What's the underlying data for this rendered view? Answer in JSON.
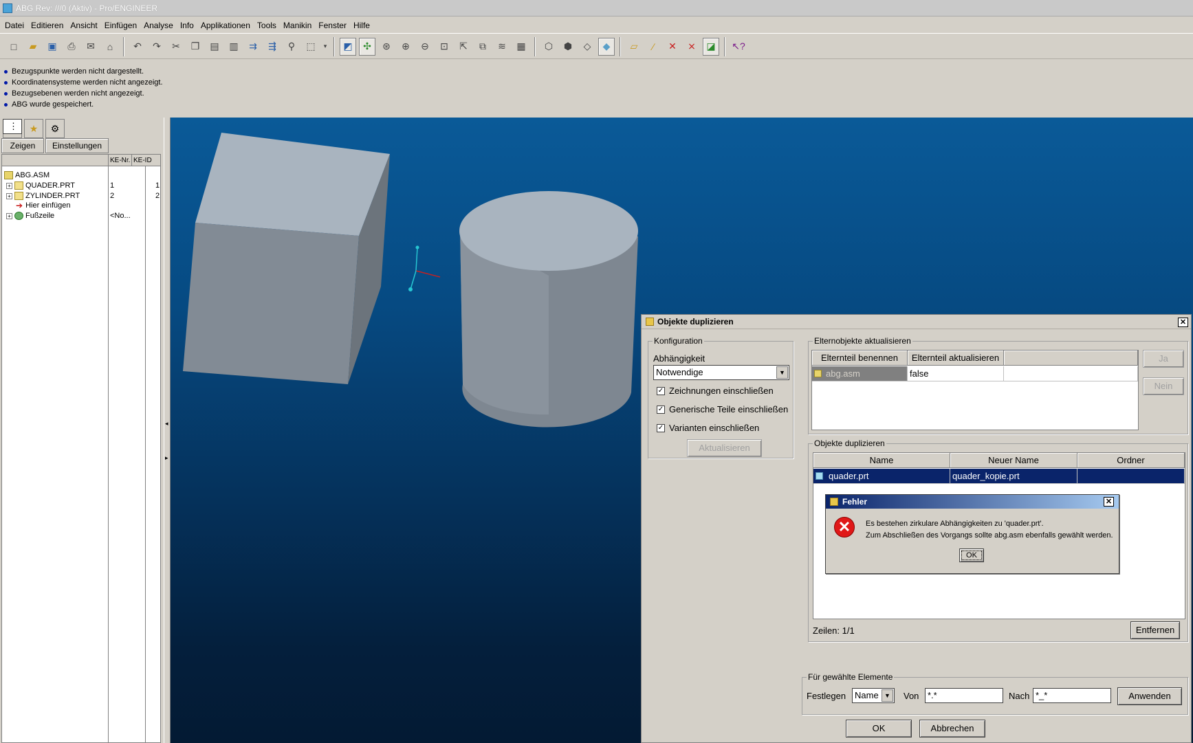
{
  "window": {
    "title": "ABG Rev: ///0 (Aktiv) - Pro/ENGINEER"
  },
  "menu": [
    "Datei",
    "Editieren",
    "Ansicht",
    "Einfügen",
    "Analyse",
    "Info",
    "Applikationen",
    "Tools",
    "Manikin",
    "Fenster",
    "Hilfe"
  ],
  "messages": [
    "Bezugspunkte werden nicht dargestellt.",
    "Koordinatensysteme werden nicht angezeigt.",
    "Bezugsebenen werden nicht angezeigt.",
    "ABG wurde gespeichert."
  ],
  "tree": {
    "show_button": "Zeigen",
    "settings_button": "Einstellungen",
    "col_ke_nr": "KE-Nr.",
    "col_ke_id": "KE-ID",
    "root": "ABG.ASM",
    "items": [
      {
        "label": "QUADER.PRT",
        "ke_nr": "1",
        "ke_id": "1"
      },
      {
        "label": "ZYLINDER.PRT",
        "ke_nr": "2",
        "ke_id": "2"
      },
      {
        "label": "Hier einfügen",
        "ke_nr": "",
        "ke_id": ""
      },
      {
        "label": "Fußzeile",
        "ke_nr": "<No...",
        "ke_id": ""
      }
    ]
  },
  "dialog": {
    "title": "Objekte duplizieren",
    "config": {
      "group_label": "Konfiguration",
      "dependency_label": "Abhängigkeit",
      "dependency_value": "Notwendige",
      "chk_drawings": "Zeichnungen einschließen",
      "chk_generic": "Generische Teile einschließen",
      "chk_variants": "Varianten einschließen",
      "update_button": "Aktualisieren"
    },
    "parents": {
      "group_label": "Elternobjekte aktualisieren",
      "col_name": "Elternteil benennen",
      "col_update": "Elternteil aktualisieren",
      "row_name": "abg.asm",
      "row_update": "false",
      "yes_button": "Ja",
      "no_button": "Nein"
    },
    "duplicate": {
      "group_label": "Objekte duplizieren",
      "col_name": "Name",
      "col_new_name": "Neuer Name",
      "col_folder": "Ordner",
      "row_name": "quader.prt",
      "row_new_name": "quader_kopie.prt",
      "row_folder": "",
      "rows_label": "Zeilen: 1/1",
      "remove_button": "Entfernen"
    },
    "selected": {
      "group_label": "Für gewählte Elemente",
      "set_label": "Festlegen",
      "set_value": "Name",
      "from_label": "Von",
      "from_value": "*.*",
      "to_label": "Nach",
      "to_value": "*_*",
      "apply_button": "Anwenden"
    },
    "ok_button": "OK",
    "cancel_button": "Abbrechen"
  },
  "error": {
    "title": "Fehler",
    "line1": "Es bestehen zirkulare Abhängigkeiten zu 'quader.prt'.",
    "line2": "Zum Abschließen des Vorgangs sollte abg.asm ebenfalls gewählt werden.",
    "ok_button": "OK"
  },
  "colors": {
    "viewport_top": "#0a5a98",
    "viewport_bottom": "#031a33",
    "selection": "#0a246a",
    "shape_face": "#a9b4bf"
  }
}
